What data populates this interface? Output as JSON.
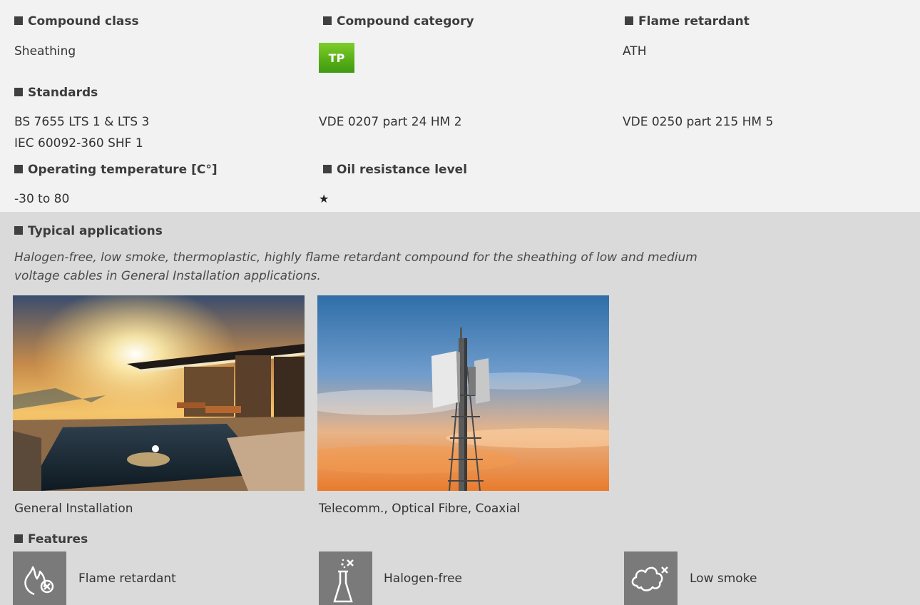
{
  "compound_class": {
    "header": "Compound class",
    "value": "Sheathing"
  },
  "compound_category": {
    "header": "Compound category",
    "badge": "TP",
    "badge_color": "#5cb31a"
  },
  "flame_retardant": {
    "header": "Flame retardant",
    "value": "ATH"
  },
  "standards": {
    "header": "Standards",
    "col1_line1": "BS 7655 LTS 1 & LTS 3",
    "col1_line2": "IEC 60092-360 SHF 1",
    "col2": "VDE 0207 part 24 HM 2",
    "col3": "VDE 0250 part 215 HM 5"
  },
  "operating_temperature": {
    "header": "Operating temperature [C°]",
    "value": "-30 to 80"
  },
  "oil_resistance": {
    "header": "Oil resistance level",
    "value": "★"
  },
  "typical_applications": {
    "header": "Typical applications",
    "description_line1": "Halogen-free, low smoke, thermoplastic, highly flame retardant compound for the sheathing of low and medium",
    "description_line2": "voltage cables in General Installation applications.",
    "images": [
      {
        "caption": "General Installation",
        "icon": "modern-house-pool-photo"
      },
      {
        "caption": "Telecomm., Optical Fibre, Coaxial",
        "icon": "telecom-tower-photo"
      }
    ]
  },
  "features": {
    "header": "Features",
    "items": [
      {
        "label": "Flame retardant",
        "icon": "flame-retardant-icon"
      },
      {
        "label": "Halogen-free",
        "icon": "halogen-free-icon"
      },
      {
        "label": "Low smoke",
        "icon": "low-smoke-icon"
      }
    ]
  },
  "colors": {
    "top_background": "#f2f2f2",
    "section_background": "#dadada",
    "icon_tile": "#7a7a7a"
  }
}
